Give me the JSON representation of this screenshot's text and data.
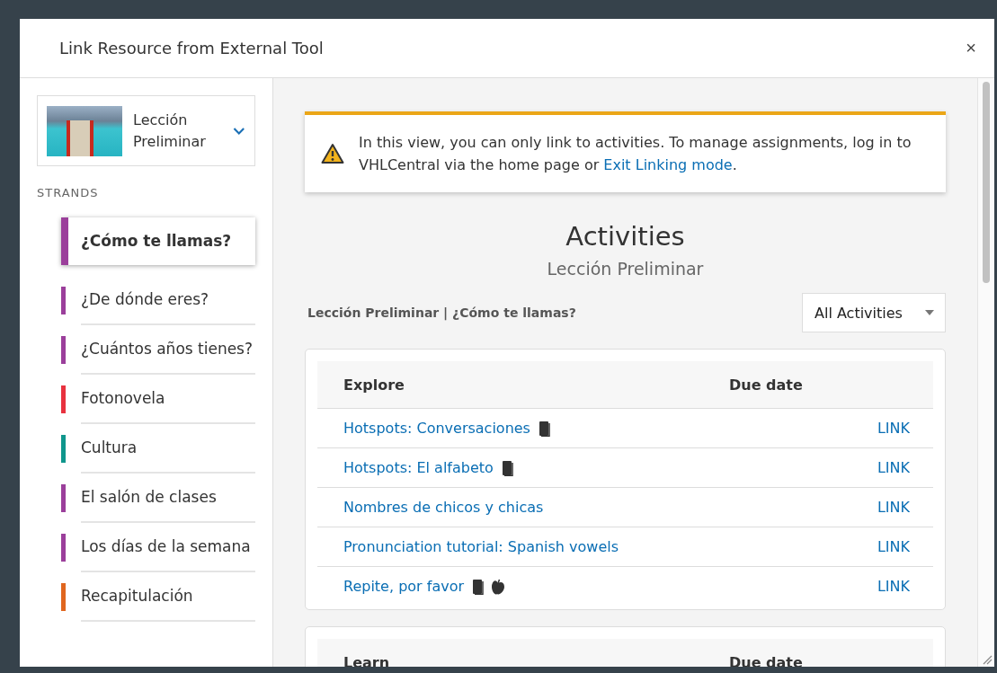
{
  "window": {
    "title": "Link Resource from External Tool",
    "close": "×"
  },
  "sidebar": {
    "lesson": {
      "label": "Lección Preliminar"
    },
    "heading": "STRANDS",
    "items": [
      {
        "label": "¿Cómo te llamas?",
        "color": "#9b3f9b",
        "selected": true
      },
      {
        "label": "¿De dónde eres?",
        "color": "#9b3f9b",
        "selected": false
      },
      {
        "label": "¿Cuántos años tienes?",
        "color": "#9b3f9b",
        "selected": false
      },
      {
        "label": "Fotonovela",
        "color": "#e8323f",
        "selected": false
      },
      {
        "label": "Cultura",
        "color": "#0f968c",
        "selected": false
      },
      {
        "label": "El salón de clases",
        "color": "#9b3f9b",
        "selected": false
      },
      {
        "label": "Los días de la semana",
        "color": "#9b3f9b",
        "selected": false
      },
      {
        "label": "Recapitulación",
        "color": "#e0661f",
        "selected": false
      }
    ]
  },
  "notice": {
    "text": "In this view, you can only link to activities. To manage assignments, log in to VHLCentral via the home page or ",
    "link": "Exit Linking mode",
    "after": "."
  },
  "heading": "Activities",
  "subheading": "Lección Preliminar",
  "breadcrumb": "Lección Preliminar | ¿Cómo te llamas?",
  "filter": {
    "value": "All Activities"
  },
  "sections": [
    {
      "columns": [
        "Explore",
        "Due date"
      ],
      "rows": [
        {
          "title": "Hotspots: Conversaciones",
          "icons": [
            {
              "kind": "book"
            }
          ],
          "action": "LINK"
        },
        {
          "title": "Hotspots: El alfabeto",
          "icons": [
            {
              "kind": "book"
            }
          ],
          "action": "LINK"
        },
        {
          "title": "Nombres de chicos y chicas",
          "action": "LINK"
        },
        {
          "title": "Pronunciation tutorial: Spanish vowels",
          "action": "LINK"
        },
        {
          "title": "Repite, por favor",
          "icons": [
            {
              "kind": "book"
            },
            {
              "kind": "apple"
            }
          ],
          "action": "LINK"
        }
      ]
    },
    {
      "columns": [
        "Learn",
        "Due date"
      ]
    }
  ]
}
